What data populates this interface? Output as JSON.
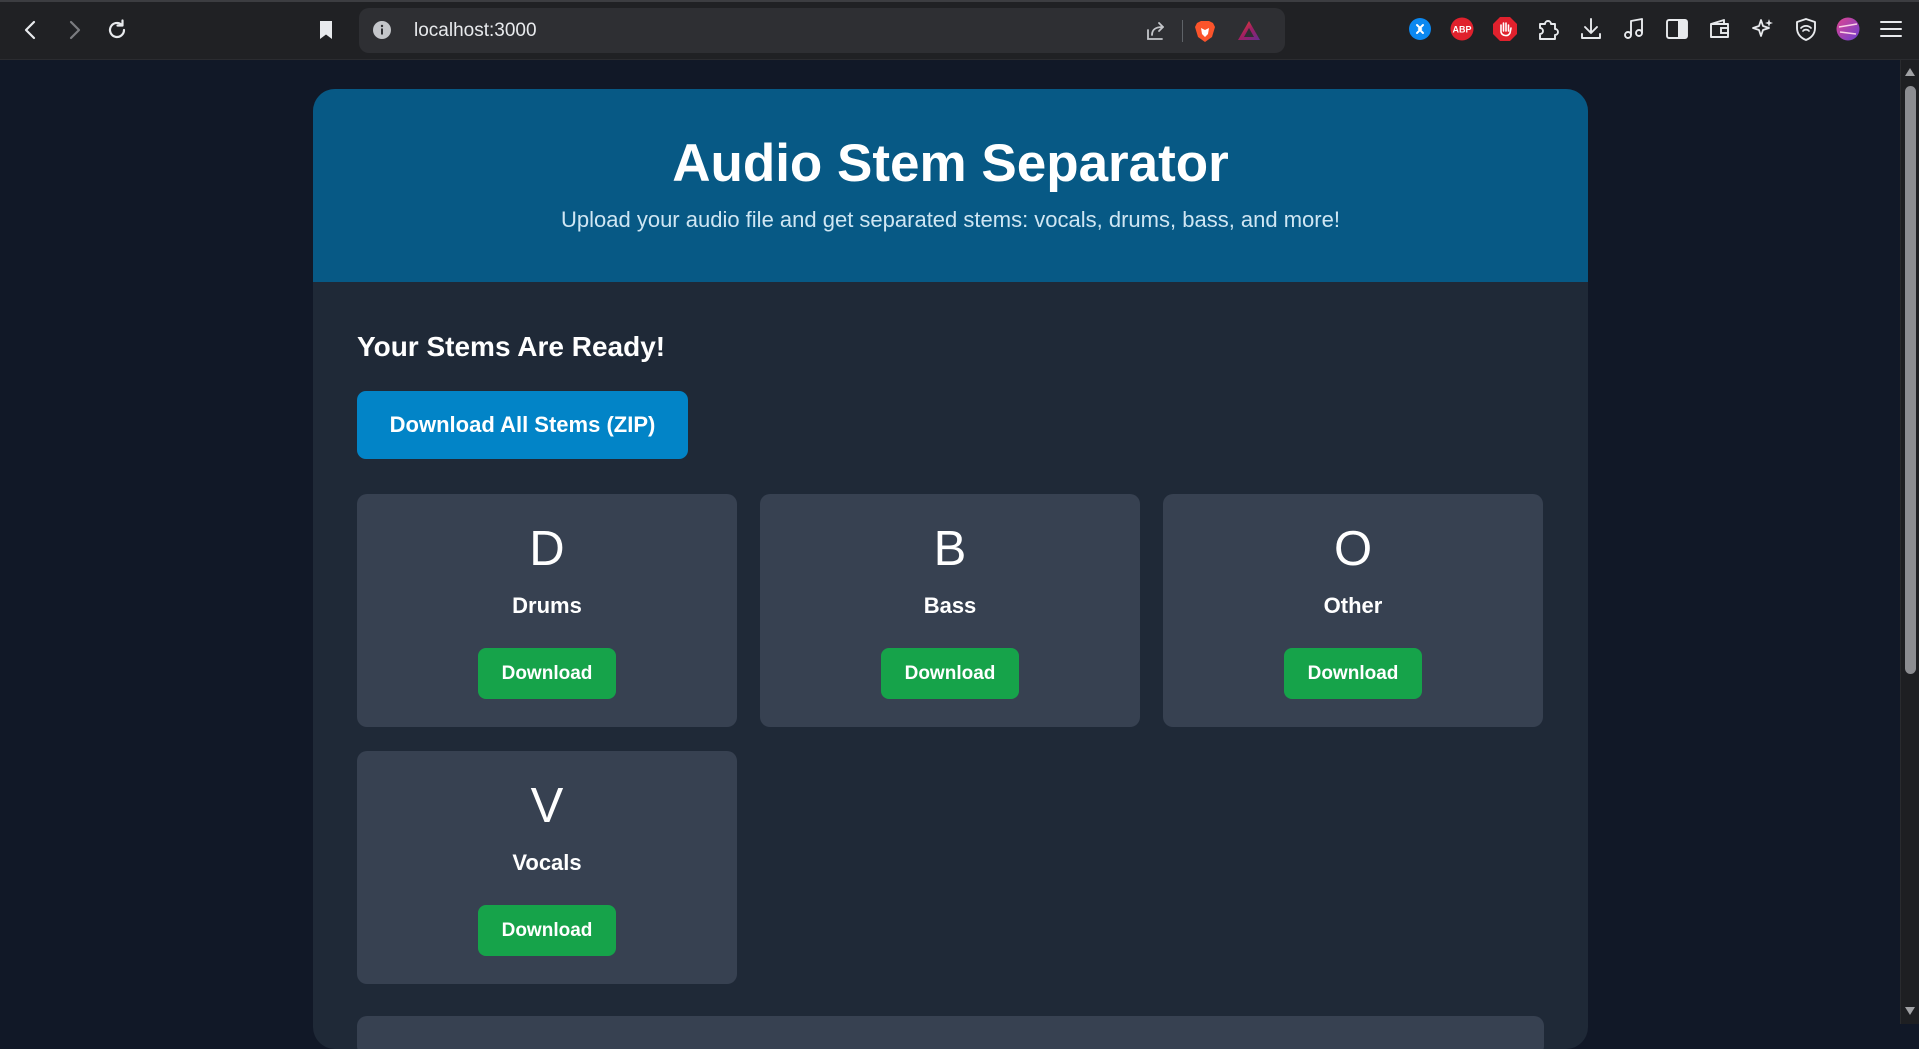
{
  "browser": {
    "url": "localhost:3000"
  },
  "app": {
    "title": "Audio Stem Separator",
    "subtitle": "Upload your audio file and get separated stems: vocals, drums, bass, and more!",
    "ready_heading": "Your Stems Are Ready!",
    "zip_button_label": "Download All Stems (ZIP)",
    "stems": [
      {
        "letter": "D",
        "name": "Drums",
        "button_label": "Download"
      },
      {
        "letter": "B",
        "name": "Bass",
        "button_label": "Download"
      },
      {
        "letter": "O",
        "name": "Other",
        "button_label": "Download"
      },
      {
        "letter": "V",
        "name": "Vocals",
        "button_label": "Download"
      }
    ]
  },
  "colors": {
    "page_bg": "#111827",
    "hero_bg": "#075985",
    "card_bg": "#1f2937",
    "stem_card_bg": "#374151",
    "zip_button": "#0284c7",
    "download_button": "#16a34a"
  },
  "icons": {
    "back": "back-arrow-icon",
    "forward": "forward-arrow-icon",
    "reload": "reload-icon",
    "bookmark": "bookmark-icon",
    "site_info": "info-icon",
    "share": "share-icon",
    "brave_shields": "brave-lion-icon",
    "brave_rewards": "brave-rewards-icon",
    "extensions": [
      "shazam-icon",
      "adblock-plus-icon",
      "stop-hand-icon",
      "puzzle-icon",
      "download-icon",
      "music-note-icon",
      "sidebar-icon",
      "wallet-icon",
      "leo-ai-icon",
      "vpn-shield-icon",
      "profile-avatar-icon",
      "menu-icon"
    ]
  }
}
